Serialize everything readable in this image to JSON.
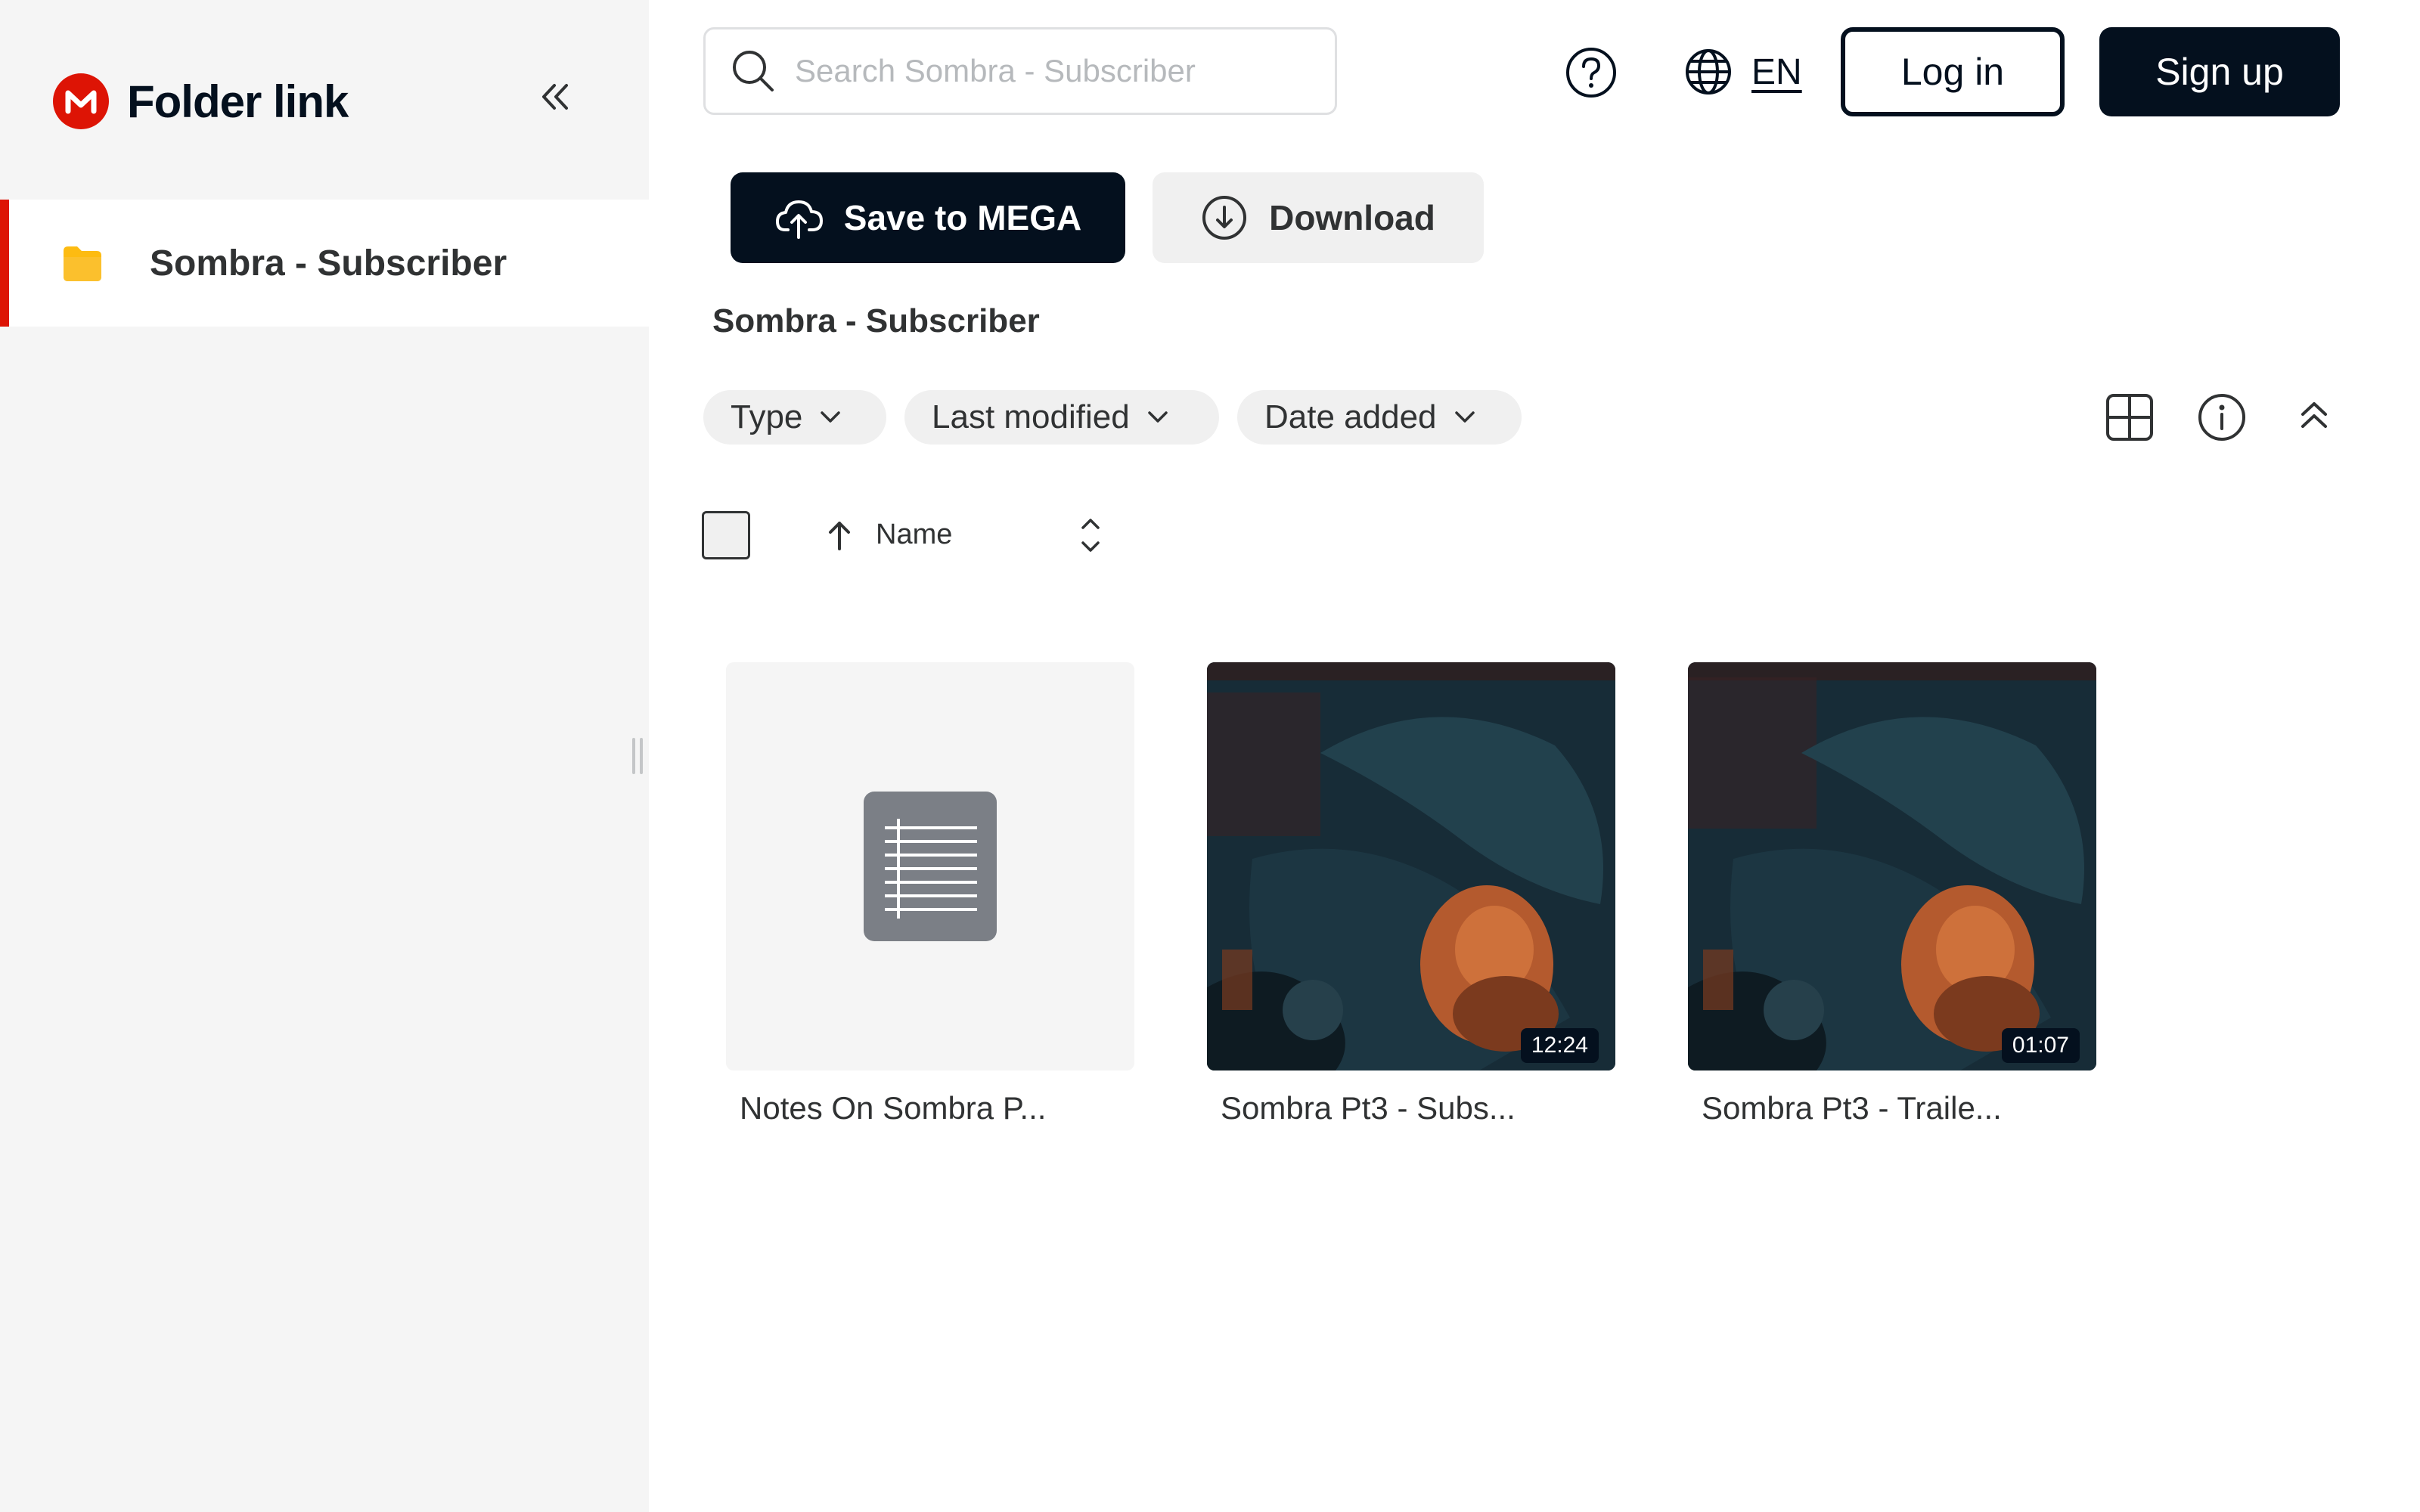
{
  "sidebar": {
    "title": "Folder link",
    "logo_letter": "M",
    "items": [
      {
        "label": "Sombra - Subscriber",
        "icon": "folder-icon",
        "active": true
      }
    ]
  },
  "header": {
    "search_placeholder": "Search Sombra - Subscriber",
    "language": "EN",
    "login_label": "Log in",
    "signup_label": "Sign up"
  },
  "actions": {
    "save_label": "Save to MEGA",
    "download_label": "Download"
  },
  "breadcrumb": "Sombra - Subscriber",
  "filters": {
    "type_label": "Type",
    "modified_label": "Last modified",
    "date_added_label": "Date added"
  },
  "list_header": {
    "name_label": "Name"
  },
  "files": [
    {
      "name": "Notes On Sombra P...",
      "kind": "document",
      "icon": "document-icon"
    },
    {
      "name": "Sombra Pt3 - Subs...",
      "kind": "video",
      "duration": "12:24"
    },
    {
      "name": "Sombra Pt3 - Traile...",
      "kind": "video",
      "duration": "01:07"
    }
  ],
  "colors": {
    "brand_red": "#dd1405",
    "primary_dark": "#04101e",
    "sidebar_bg": "#f5f5f5",
    "chip_bg": "#f0f0f0",
    "folder_yellow": "#fdbb11"
  }
}
